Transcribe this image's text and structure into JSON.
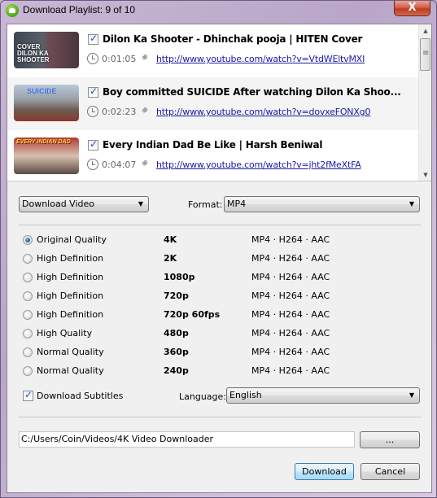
{
  "window": {
    "title": "Download Playlist: 9 of 10",
    "close_label": "X"
  },
  "playlist": {
    "items": [
      {
        "title": "Dilon Ka Shooter - Dhinchak pooja | HITEN Cover",
        "duration": "0:01:05",
        "url": "http://www.youtube.com/watch?v=VtdWEltvMXI",
        "checked": true,
        "thumb_text": "COVER\nDILON KA SHOOTER"
      },
      {
        "title": "Boy committed SUICIDE After watching Dilon Ka Shoo...",
        "duration": "0:02:23",
        "url": "http://www.youtube.com/watch?v=dovxeFONXg0",
        "checked": true,
        "thumb_text": "SUICIDE"
      },
      {
        "title": "Every Indian Dad Be Like | Harsh Beniwal",
        "duration": "0:04:07",
        "url": "http://www.youtube.com/watch?v=jht2fMeXtFA",
        "checked": true,
        "thumb_text": "EVERY INDIAN DAD"
      }
    ]
  },
  "options": {
    "action": "Download Video",
    "format_label": "Format:",
    "format": "MP4"
  },
  "qualities": [
    {
      "name": "Original Quality",
      "resolution": "4K",
      "format": "MP4 · H264 · AAC",
      "selected": true
    },
    {
      "name": "High Definition",
      "resolution": "2K",
      "format": "MP4 · H264 · AAC",
      "selected": false
    },
    {
      "name": "High Definition",
      "resolution": "1080p",
      "format": "MP4 · H264 · AAC",
      "selected": false
    },
    {
      "name": "High Definition",
      "resolution": "720p",
      "format": "MP4 · H264 · AAC",
      "selected": false
    },
    {
      "name": "High Definition",
      "resolution": "720p 60fps",
      "format": "MP4 · H264 · AAC",
      "selected": false
    },
    {
      "name": "High Quality",
      "resolution": "480p",
      "format": "MP4 · H264 · AAC",
      "selected": false
    },
    {
      "name": "Normal Quality",
      "resolution": "360p",
      "format": "MP4 · H264 · AAC",
      "selected": false
    },
    {
      "name": "Normal Quality",
      "resolution": "240p",
      "format": "MP4 · H264 · AAC",
      "selected": false
    }
  ],
  "subtitles": {
    "label": "Download Subtitles",
    "checked": true,
    "language_label": "Language:",
    "language": "English"
  },
  "path": {
    "value": "C:/Users/Coin/Videos/4K Video Downloader",
    "browse_label": "..."
  },
  "buttons": {
    "download": "Download",
    "cancel": "Cancel"
  }
}
